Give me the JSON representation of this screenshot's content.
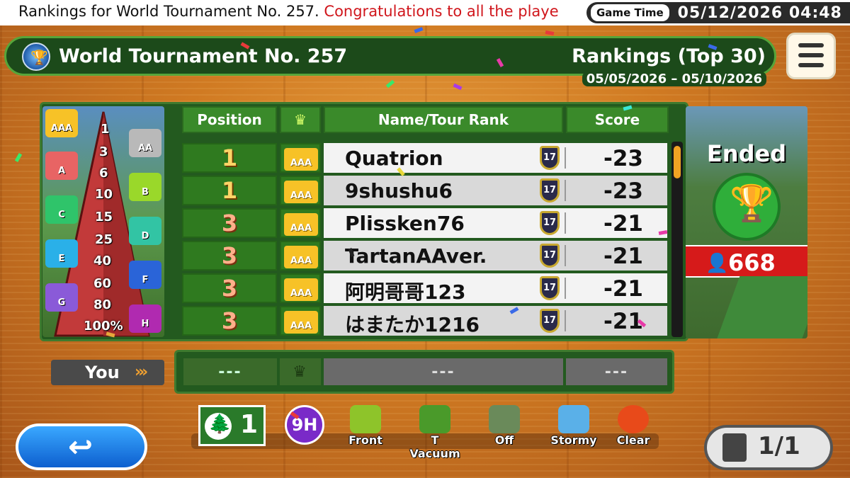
{
  "ticker": {
    "text_normal": "Rankings for World Tournament No. 257.",
    "text_highlight": "Congratulations to all the playe",
    "game_time_label": "Game Time",
    "game_time_value": "05/12/2026 04:48"
  },
  "header": {
    "tournament_title": "World Tournament No. 257",
    "rankings_title": "Rankings (Top 30)",
    "date_range": "05/05/2026 – 05/10/2026",
    "menu_icon": "hamburger-menu-icon"
  },
  "pyramid": {
    "thresholds": [
      "1",
      "3",
      "6",
      "10",
      "15",
      "25",
      "40",
      "60",
      "80",
      "100%"
    ],
    "tiers": [
      "AAA",
      "AA",
      "A",
      "B",
      "C",
      "D",
      "E",
      "F",
      "G",
      "H"
    ]
  },
  "columns": {
    "position": "Position",
    "name": "Name/Tour Rank",
    "score": "Score"
  },
  "rows": [
    {
      "position": "1",
      "crown": "AAA",
      "name": "Quatrion",
      "tour_rank": "17",
      "score": "-23"
    },
    {
      "position": "1",
      "crown": "AAA",
      "name": "9shushu6",
      "tour_rank": "17",
      "score": "-23"
    },
    {
      "position": "3",
      "crown": "AAA",
      "name": "Plissken76",
      "tour_rank": "17",
      "score": "-21"
    },
    {
      "position": "3",
      "crown": "AAA",
      "name": "TartanAAver.",
      "tour_rank": "17",
      "score": "-21"
    },
    {
      "position": "3",
      "crown": "AAA",
      "name": "阿明哥哥123",
      "tour_rank": "17",
      "score": "-21"
    },
    {
      "position": "3",
      "crown": "AAA",
      "name": "はまたか1216",
      "tour_rank": "17",
      "score": "-21"
    }
  ],
  "status": {
    "state": "Ended",
    "participants": "668"
  },
  "you": {
    "label": "You",
    "position": "---",
    "name": "---",
    "score": "---"
  },
  "conditions": {
    "hole_number": "1",
    "holes": "9H",
    "tee": "Front",
    "green": "T Vacuum",
    "pin": "Off",
    "wind": "Stormy",
    "weather": "Clear"
  },
  "pagination": {
    "page": "1/1"
  },
  "colors": {
    "accent_green": "#235a1f",
    "header_green": "#3a8a2a",
    "ended_red": "#d61a1a",
    "back_blue": "#0d5fcf",
    "crown_gold": "#f7c227"
  }
}
